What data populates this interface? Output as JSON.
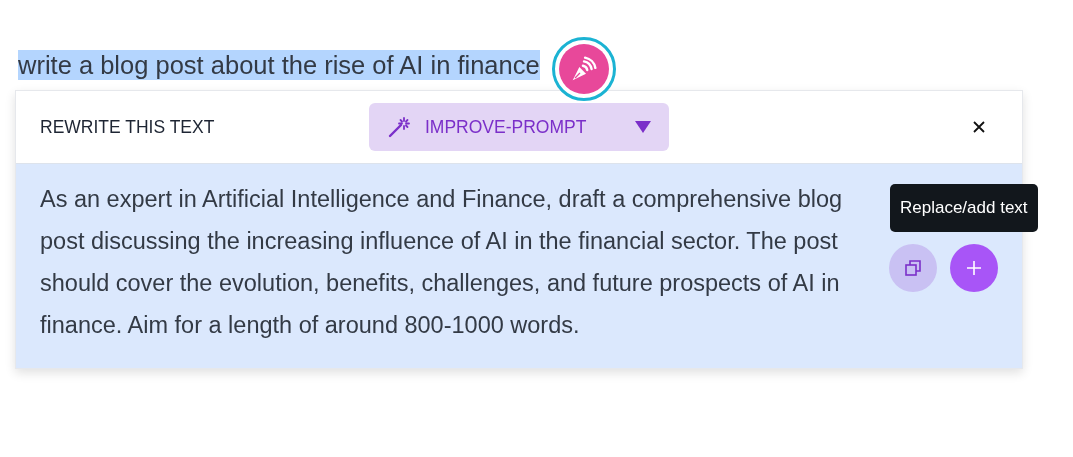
{
  "selected_text": "write a blog post about the rise of AI in finance",
  "panel": {
    "title": "REWRITE THIS TEXT",
    "mode_dropdown": {
      "label": "IMPROVE-PROMPT"
    },
    "result": "As an expert in Artificial Intelligence and Finance, draft a comprehensive blog post discussing the increasing influence of AI in the financial sector. The post should cover the evolution, benefits, challenges, and future prospects of AI in finance. Aim for a length of around 800-1000 words.",
    "tooltip": "Replace/add text"
  }
}
